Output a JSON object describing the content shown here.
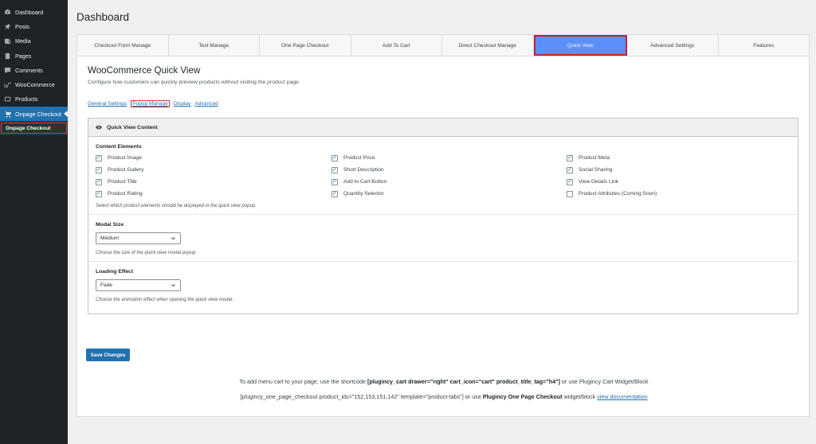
{
  "sidebar": {
    "items": [
      {
        "label": "Dashboard",
        "icon": "dashboard-icon"
      },
      {
        "label": "Posts",
        "icon": "pin-icon"
      },
      {
        "label": "Media",
        "icon": "media-icon"
      },
      {
        "label": "Pages",
        "icon": "pages-icon"
      },
      {
        "label": "Comments",
        "icon": "comment-icon"
      },
      {
        "label": "WooCommerce",
        "icon": "woo-icon"
      },
      {
        "label": "Products",
        "icon": "products-icon"
      },
      {
        "label": "Onpage Checkout",
        "icon": "cart-icon"
      }
    ],
    "submenu_label": "Onpage Checkout"
  },
  "page_title": "Dashboard",
  "tabs": [
    "Checkout Form Manage",
    "Text Manage",
    "One Page Checkout",
    "Add To Cart",
    "Direct Checkout Manage",
    "Quick View",
    "Advanced Settings",
    "Features"
  ],
  "active_tab": "Quick View",
  "heading": "WooCommerce Quick View",
  "description": "Configure how customers can quickly preview products without visiting the product page.",
  "subnav": [
    "General Settings",
    "Popup Manage",
    "Display",
    "Advanced"
  ],
  "subnav_active": "Popup Manage",
  "box_title": "Quick View Content",
  "content_elements": {
    "label": "Content Elements",
    "items": [
      {
        "label": "Product Image",
        "checked": true
      },
      {
        "label": "Product Price",
        "checked": true
      },
      {
        "label": "Product Meta",
        "checked": true
      },
      {
        "label": "Product Gallery",
        "checked": true
      },
      {
        "label": "Short Description",
        "checked": true
      },
      {
        "label": "Social Sharing",
        "checked": true
      },
      {
        "label": "Product Title",
        "checked": true
      },
      {
        "label": "Add to Cart Button",
        "checked": true
      },
      {
        "label": "View Details Link",
        "checked": true
      },
      {
        "label": "Product Rating",
        "checked": true
      },
      {
        "label": "Quantity Selector",
        "checked": true
      },
      {
        "label": "Product Attributes (Coming Soon)",
        "checked": false
      }
    ],
    "help": "Select which product elements should be displayed in the quick view popup."
  },
  "modal_size": {
    "label": "Modal Size",
    "value": "Medium",
    "help": "Choose the size of the quick view modal popup."
  },
  "loading_effect": {
    "label": "Loading Effect",
    "value": "Fade",
    "help": "Choose the animation effect when opening the quick view modal."
  },
  "save_label": "Save Changes",
  "info": {
    "line1_pre": "To add menu cart to your page, use the shortcode ",
    "line1_code": "[plugincy_cart drawer=\"right\" cart_icon=\"cart\" product_title_tag=\"h4\"]",
    "line1_post": " or use Plugincy Cart Widget/Block",
    "line2_pre": "[plugincy_one_page_checkout product_ids=\"152,153,151,142\" template=\"product-tabs\"] or use ",
    "line2_bold": "Plugincy One Page Checkout",
    "line2_mid": " widget/block ",
    "line2_link": "view documentation"
  },
  "colors": {
    "accent": "#2271b1",
    "active_tab": "#5b8ff9",
    "highlight": "#d63638",
    "sidebar": "#1d2327"
  }
}
